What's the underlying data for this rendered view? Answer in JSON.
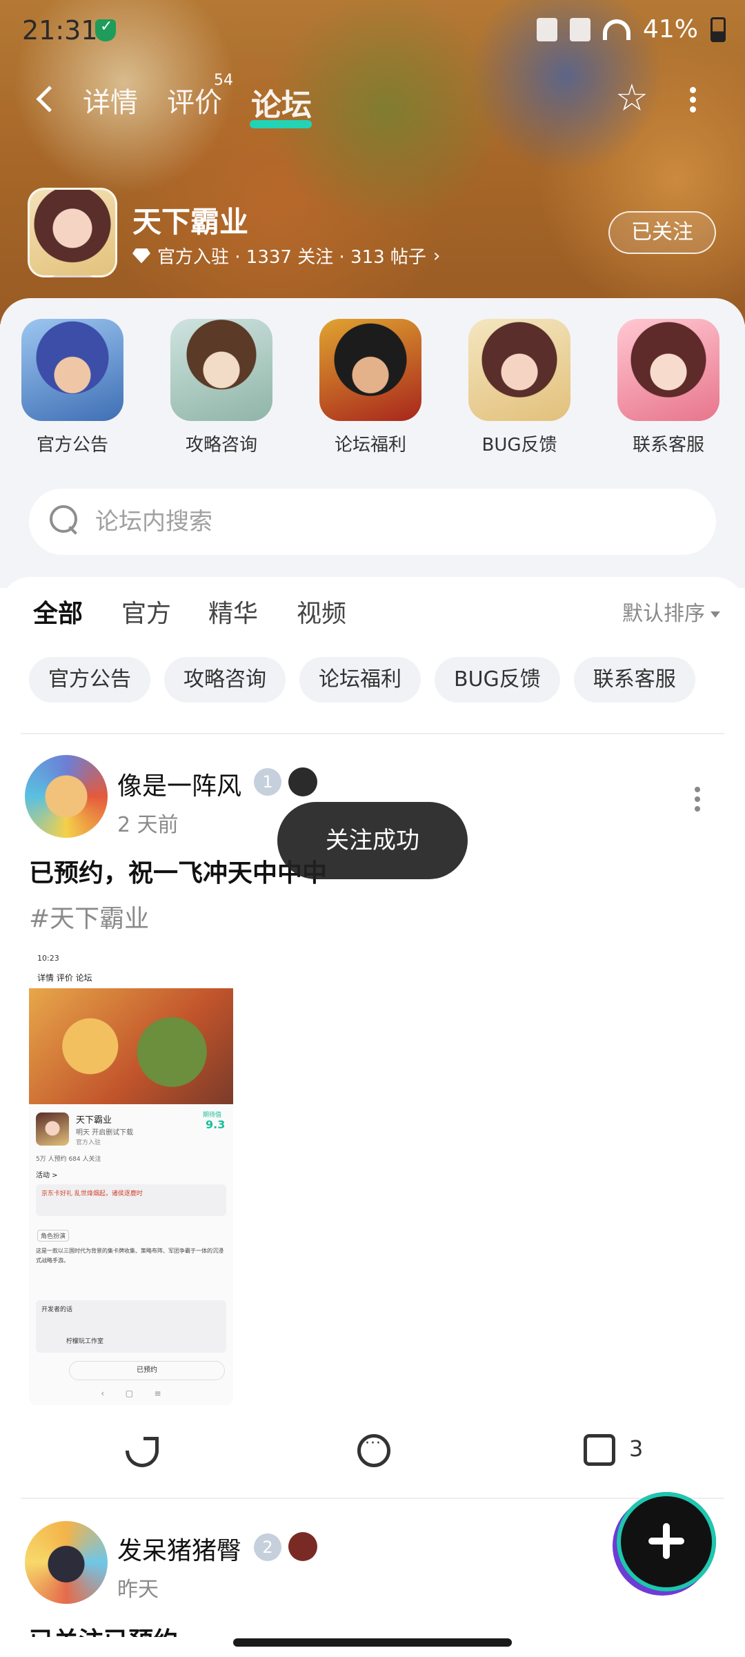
{
  "status_bar": {
    "time": "21:31",
    "battery": "41%"
  },
  "nav": {
    "tabs": [
      {
        "label": "详情",
        "active": false
      },
      {
        "label": "评价",
        "active": false
      },
      {
        "label": "论坛",
        "active": true
      }
    ],
    "review_count": "54"
  },
  "game": {
    "name": "天下霸业",
    "meta": "官方入驻 · 1337 关注 · 313 帖子",
    "follow_label": "已关注"
  },
  "categories": [
    {
      "label": "官方公告"
    },
    {
      "label": "攻略咨询"
    },
    {
      "label": "论坛福利"
    },
    {
      "label": "BUG反馈"
    },
    {
      "label": "联系客服"
    }
  ],
  "search": {
    "placeholder": "论坛内搜索"
  },
  "filter_tabs": [
    {
      "label": "全部",
      "active": true
    },
    {
      "label": "官方",
      "active": false
    },
    {
      "label": "精华",
      "active": false
    },
    {
      "label": "视频",
      "active": false
    }
  ],
  "sort_label": "默认排序",
  "chips": [
    "官方公告",
    "攻略咨询",
    "论坛福利",
    "BUG反馈",
    "联系客服"
  ],
  "posts": [
    {
      "username": "像是一阵风",
      "level": "1",
      "time": "2 天前",
      "text": "已预约，祝一飞冲天中中中",
      "tag": "#天下霸业",
      "likes": "3",
      "screenshot": {
        "time": "10:23",
        "tabs": "详情  评价  论坛",
        "game_name": "天下霸业",
        "subtitle": "明天 开启删试下载",
        "official": "官方入驻",
        "score_label": "期待值",
        "score": "9.3",
        "stats": "5万 人预约    684 人关注",
        "activity": "活动 >",
        "event": "京东卡好礼 乱世烽烟起，诸侯逐鹿时",
        "section": "角色扮演",
        "desc": "这是一款以三国时代为背景的集卡牌收集、策略布阵、军团争霸于一体的沉浸式战略手游。",
        "developer_note": "开发者的话",
        "studio": "柠檬玩工作室",
        "reserved": "已预约"
      }
    },
    {
      "username": "发呆猪猪臀",
      "level": "2",
      "time": "昨天",
      "text": "已关注已预约"
    }
  ],
  "toast": "关注成功",
  "colors": {
    "accent": "#22d3b6",
    "toast_bg": "#222222",
    "chip_bg": "#f1f2f5"
  }
}
